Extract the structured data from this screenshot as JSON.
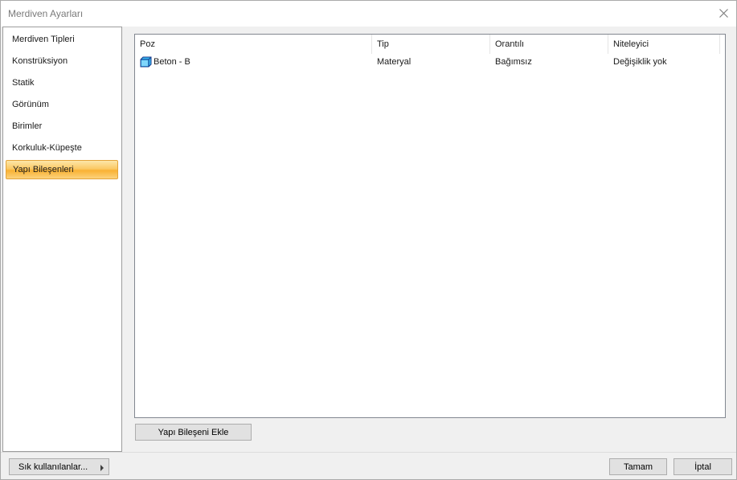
{
  "window": {
    "title": "Merdiven Ayarları"
  },
  "sidebar": {
    "items": [
      {
        "label": "Merdiven Tipleri",
        "selected": false
      },
      {
        "label": "Konstrüksiyon",
        "selected": false
      },
      {
        "label": "Statik",
        "selected": false
      },
      {
        "label": "Görünüm",
        "selected": false
      },
      {
        "label": "Birimler",
        "selected": false
      },
      {
        "label": "Korkuluk-Küpeşte",
        "selected": false
      },
      {
        "label": "Yapı Bileşenleri",
        "selected": true
      }
    ]
  },
  "table": {
    "columns": [
      "Poz",
      "Tip",
      "Orantılı",
      "Niteleyici"
    ],
    "rows": [
      {
        "icon": "cube-icon",
        "poz": "Beton - B",
        "tip": "Materyal",
        "orantili": "Bağımsız",
        "niteleyici": "Değişiklik yok"
      }
    ]
  },
  "buttons": {
    "add_component": "Yapı Bileşeni Ekle",
    "favorites": "Sık kullanılanlar...",
    "ok": "Tamam",
    "cancel": "İptal"
  },
  "colors": {
    "selection_top": "#fde6a8",
    "selection_bottom": "#f9b234",
    "icon_fill": "#35b6f0"
  }
}
